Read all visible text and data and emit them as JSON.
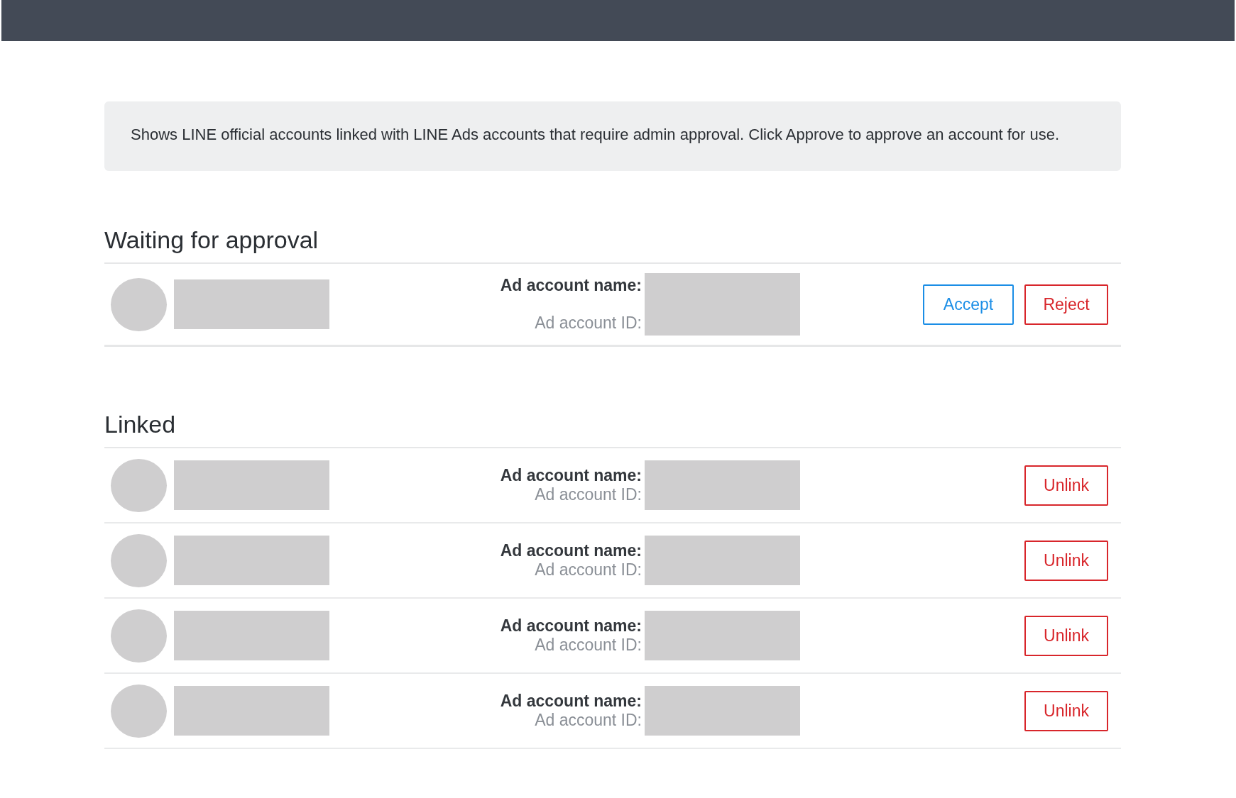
{
  "notice": "Shows LINE official accounts linked with LINE Ads accounts that require admin approval. Click Approve to approve an account for use.",
  "sections": [
    {
      "title": "Waiting for approval",
      "rows": [
        {
          "name_label": "Ad account name:",
          "id_label": "Ad account ID:",
          "buttons": [
            {
              "kind": "accept",
              "label": "Accept"
            },
            {
              "kind": "reject",
              "label": "Reject"
            }
          ]
        }
      ]
    },
    {
      "title": "Linked",
      "rows": [
        {
          "name_label": "Ad account name:",
          "id_label": "Ad account ID:",
          "buttons": [
            {
              "kind": "reject",
              "label": "Unlink"
            }
          ]
        },
        {
          "name_label": "Ad account name:",
          "id_label": "Ad account ID:",
          "buttons": [
            {
              "kind": "reject",
              "label": "Unlink"
            }
          ]
        },
        {
          "name_label": "Ad account name:",
          "id_label": "Ad account ID:",
          "buttons": [
            {
              "kind": "reject",
              "label": "Unlink"
            }
          ]
        },
        {
          "name_label": "Ad account name:",
          "id_label": "Ad account ID:",
          "buttons": [
            {
              "kind": "reject",
              "label": "Unlink"
            }
          ]
        }
      ]
    }
  ]
}
